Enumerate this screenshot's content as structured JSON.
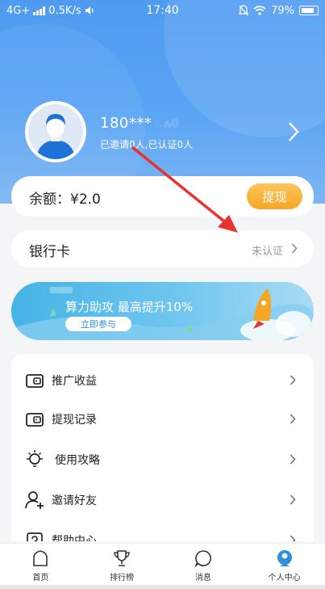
{
  "status_bar": {
    "network": "4G+",
    "speed": "0.5K/s",
    "time": "17:40",
    "battery": "79%"
  },
  "profile": {
    "phone": "180***",
    "phone_tail_obscured": "·.ʌ0",
    "invite_stats": "已邀请0人,已认证0人"
  },
  "balance": {
    "label": "余额：¥2.0",
    "withdraw_label": "提现"
  },
  "bank_card": {
    "label": "银行卡",
    "status": "未认证"
  },
  "banner": {
    "title": "算力助攻 最高提升10%",
    "button_label": "立即参与"
  },
  "menu": {
    "items": [
      {
        "label": "推广收益",
        "icon": "wallet-icon"
      },
      {
        "label": "提现记录",
        "icon": "wallet-icon"
      },
      {
        "label": "使用攻略",
        "icon": "lightbulb-icon"
      },
      {
        "label": "邀请好友",
        "icon": "add-user-icon"
      },
      {
        "label": "帮助中心",
        "icon": "help-icon"
      }
    ]
  },
  "tabbar": {
    "items": [
      {
        "label": "首页",
        "icon": "home-icon",
        "active": false
      },
      {
        "label": "排行榜",
        "icon": "trophy-icon",
        "active": false
      },
      {
        "label": "消息",
        "icon": "message-icon",
        "active": false
      },
      {
        "label": "个人中心",
        "icon": "profile-icon",
        "active": true
      }
    ]
  },
  "colors": {
    "header_blue": "#4f9bf2",
    "accent_orange": "#f5a623",
    "arrow_red": "#e8322e",
    "active_tab": "#2d8fd6"
  }
}
